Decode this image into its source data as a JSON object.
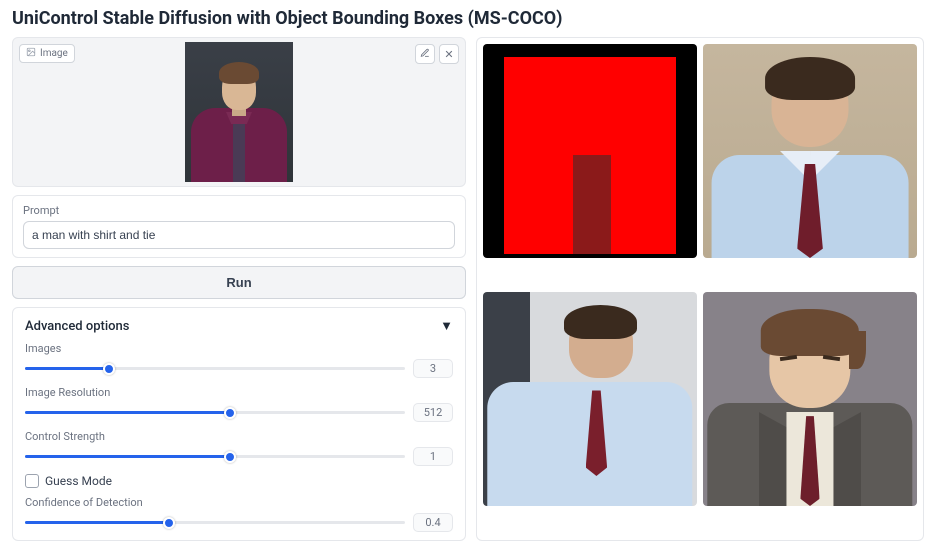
{
  "title": "UniControl Stable Diffusion with Object Bounding Boxes (MS-COCO)",
  "image_box": {
    "tag_label": "Image"
  },
  "prompt": {
    "label": "Prompt",
    "value": "a man with shirt and tie"
  },
  "run_label": "Run",
  "advanced": {
    "header": "Advanced options",
    "caret": "▼",
    "options": {
      "images": {
        "label": "Images",
        "value": "3",
        "fill_pct": 22
      },
      "resolution": {
        "label": "Image Resolution",
        "value": "512",
        "fill_pct": 54
      },
      "strength": {
        "label": "Control Strength",
        "value": "1",
        "fill_pct": 54
      },
      "guess_mode": {
        "label": "Guess Mode",
        "checked": false
      },
      "confidence": {
        "label": "Confidence of Detection",
        "value": "0.4",
        "fill_pct": 38
      }
    }
  }
}
